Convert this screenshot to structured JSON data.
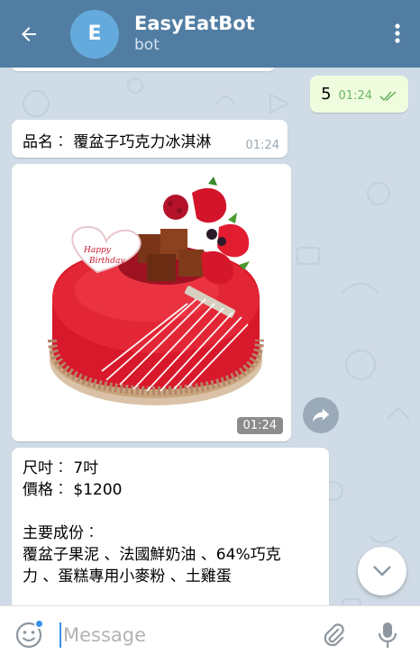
{
  "header": {
    "avatar_letter": "E",
    "title": "EasyEatBot",
    "subtitle": "bot",
    "colors": {
      "bar": "#517da2",
      "avatar": "#65aadd"
    }
  },
  "messages": {
    "outgoing": {
      "text": "5",
      "time": "01:24",
      "status": "read-double-check"
    },
    "name": {
      "text": "品名︰ 覆盆子巧克力冰淇淋",
      "time": "01:24"
    },
    "photo": {
      "time": "01:24",
      "subject": "red raspberry chocolate mousse cake with Happy Birthday plaque"
    },
    "description": {
      "lines": [
        "尺吋︰ 7吋",
        "價格︰ $1200",
        "",
        "主要成份︰",
        "覆盆子果泥 、法國鮮奶油 、64%巧克",
        "力 、蛋糕專用小麥粉 、土雞蛋"
      ]
    }
  },
  "input": {
    "placeholder": "Message"
  },
  "icons": [
    "back-arrow-icon",
    "more-vert-icon",
    "share-icon",
    "chevron-down-icon",
    "emoji-icon",
    "attach-icon",
    "mic-icon",
    "double-check-icon"
  ]
}
